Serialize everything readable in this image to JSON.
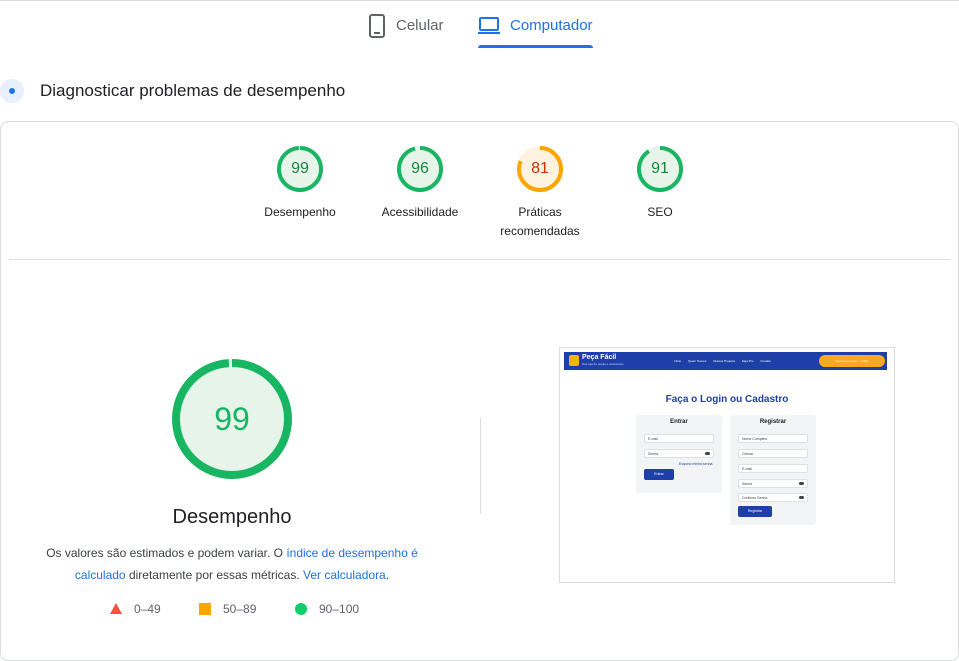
{
  "tabs": {
    "mobile_label": "Celular",
    "desktop_label": "Computador",
    "active": "desktop"
  },
  "section": {
    "title": "Diagnosticar problemas de desempenho"
  },
  "scores": [
    {
      "label": "Desempenho",
      "value": "99",
      "color": "#18b663",
      "fill": "#e6f4ea",
      "percent": 99
    },
    {
      "label": "Acessibilidade",
      "value": "96",
      "color": "#18b663",
      "fill": "#e6f4ea",
      "percent": 96
    },
    {
      "label": "Práticas recomendadas",
      "value": "81",
      "color": "#ffa400",
      "fill": "#fff3e0",
      "percent": 81
    },
    {
      "label": "SEO",
      "value": "91",
      "color": "#18b663",
      "fill": "#e6f4ea",
      "percent": 91
    }
  ],
  "main_score": {
    "value": "99",
    "percent": 99,
    "title": "Desempenho",
    "color": "#18b663"
  },
  "description": {
    "part1": "Os valores são estimados e podem variar. O ",
    "link1": "índice de desempenho é calculado",
    "part2": " diretamente por essas métricas. ",
    "link2": "Ver calculadora",
    "part3": "."
  },
  "legend": [
    {
      "range": "0–49",
      "shape": "triangle",
      "color": "#ff4e42"
    },
    {
      "range": "50–89",
      "shape": "square",
      "color": "#ffa400"
    },
    {
      "range": "90–100",
      "shape": "circle",
      "color": "#0cce6b"
    }
  ],
  "screenshot": {
    "brand": "Peça Fácil",
    "brand_sub": "Sua loja de peças e acessórios",
    "menu": [
      "Início",
      "Quem Somos",
      "Nossos Projetos",
      "Seja Pro",
      "Contato"
    ],
    "cta": "Conheça nossos - Grátis",
    "heading": "Faça o Login ou Cadastro",
    "login": {
      "title": "Entrar",
      "email": "E-mail",
      "password": "Senha",
      "forgot": "Esqueci minha senha",
      "button": "Entrar"
    },
    "register": {
      "title": "Registrar",
      "name": "Nome Completo",
      "phone": "Celular",
      "email": "E-mail",
      "password": "Senha",
      "confirm": "Confirme Senha",
      "button": "Registrar"
    }
  }
}
